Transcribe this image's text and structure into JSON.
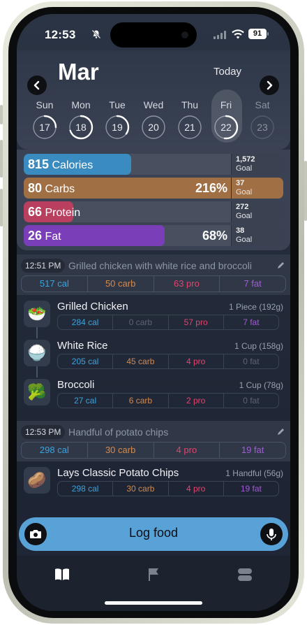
{
  "status_bar": {
    "time": "12:53",
    "battery": "91"
  },
  "header": {
    "month": "Mar",
    "today_label": "Today"
  },
  "days": [
    {
      "name": "Sun",
      "num": "17",
      "progress": 0.25
    },
    {
      "name": "Mon",
      "num": "18",
      "progress": 0.7
    },
    {
      "name": "Tue",
      "num": "19",
      "progress": 0.35
    },
    {
      "name": "Wed",
      "num": "20",
      "progress": 0
    },
    {
      "name": "Thu",
      "num": "21",
      "progress": 0
    },
    {
      "name": "Fri",
      "num": "22",
      "progress": 0.52
    },
    {
      "name": "Sat",
      "num": "23",
      "progress": 0
    }
  ],
  "macros": [
    {
      "value": "815",
      "label": "Calories",
      "pct": "",
      "goal": "1,572",
      "fill": 0.52,
      "color": "#3a8cc0"
    },
    {
      "value": "80",
      "label": "Carbs",
      "pct": "216%",
      "goal": "37",
      "fill": 1.0,
      "color": "#a06f44"
    },
    {
      "value": "66",
      "label": "Protein",
      "pct": "",
      "goal": "272",
      "fill": 0.24,
      "color": "#b8405e"
    },
    {
      "value": "26",
      "label": "Fat",
      "pct": "68%",
      "goal": "38",
      "fill": 0.68,
      "color": "#7a3fb8"
    }
  ],
  "goal_label": "Goal",
  "meals": [
    {
      "time": "12:51 PM",
      "title": "Grilled chicken with white rice and broccoli",
      "totals": {
        "cal": "517 cal",
        "carb": "50 carb",
        "pro": "63 pro",
        "fat": "7 fat"
      },
      "items": [
        {
          "name": "Grilled Chicken",
          "serving": "1 Piece (192g)",
          "icon": "🥗",
          "cal": "284 cal",
          "carb": "0 carb",
          "pro": "57 pro",
          "fat": "7 fat"
        },
        {
          "name": "White Rice",
          "serving": "1 Cup (158g)",
          "icon": "🍚",
          "cal": "205 cal",
          "carb": "45 carb",
          "pro": "4 pro",
          "fat": "0 fat"
        },
        {
          "name": "Broccoli",
          "serving": "1 Cup (78g)",
          "icon": "🥦",
          "cal": "27 cal",
          "carb": "6 carb",
          "pro": "2 pro",
          "fat": "0 fat"
        }
      ]
    },
    {
      "time": "12:53 PM",
      "title": "Handful of potato chips",
      "totals": {
        "cal": "298 cal",
        "carb": "30 carb",
        "pro": "4 pro",
        "fat": "19 fat"
      },
      "items": [
        {
          "name": "Lays Classic Potato Chips",
          "serving": "1 Handful (56g)",
          "icon": "🥔",
          "cal": "298 cal",
          "carb": "30 carb",
          "pro": "4 pro",
          "fat": "19 fat"
        }
      ]
    }
  ],
  "log_food": {
    "label": "Log food"
  },
  "tabs": [
    "book-icon",
    "flag-icon",
    "stack-icon"
  ]
}
